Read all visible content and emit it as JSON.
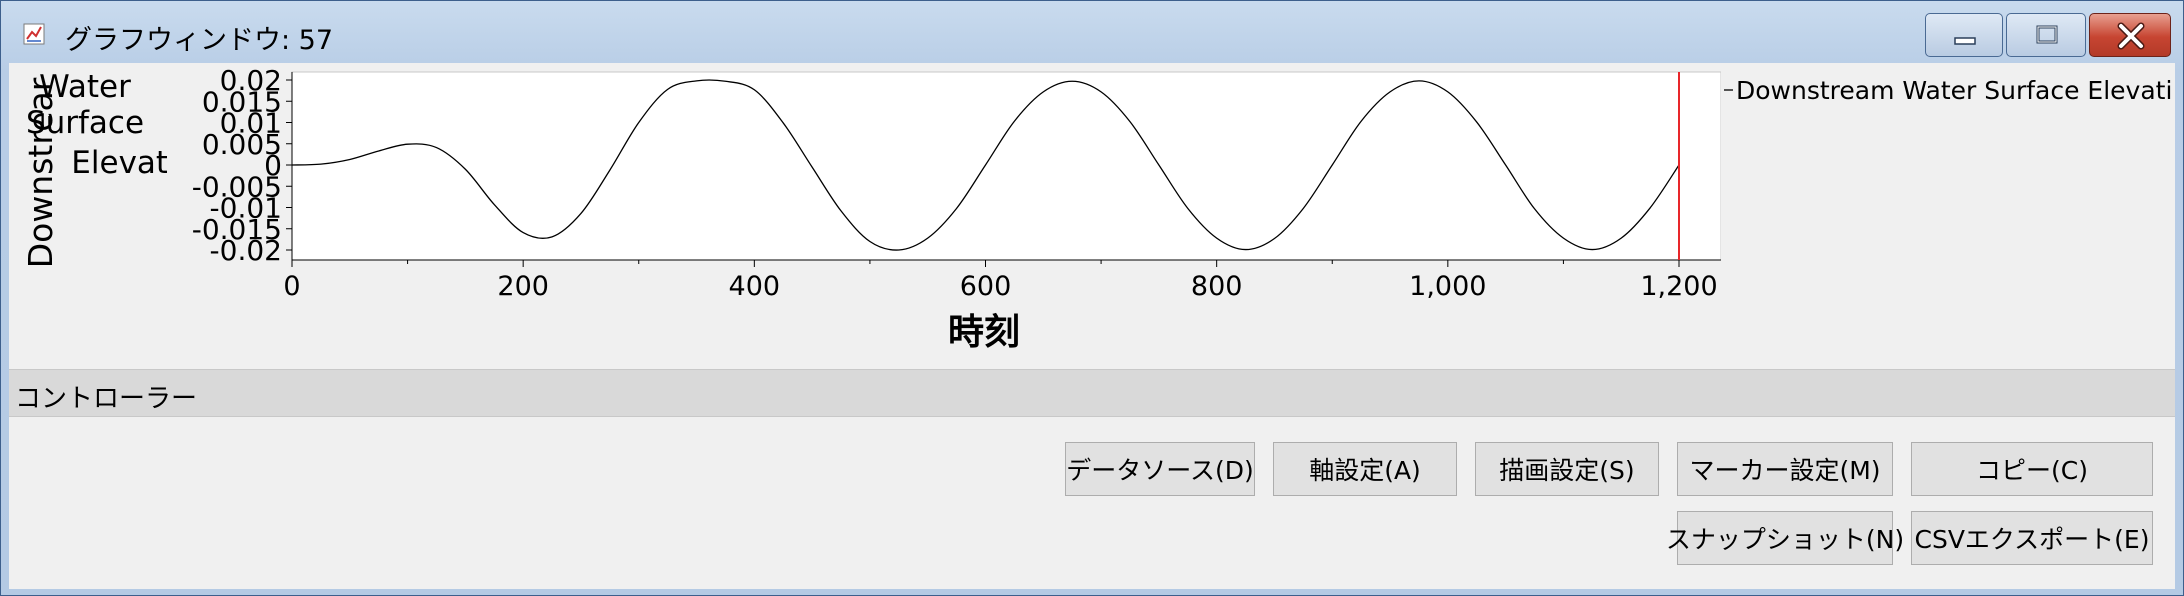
{
  "window": {
    "title": "グラフウィンドウ: 57",
    "controls": [
      "minimize-icon",
      "maximize-icon",
      "close-icon"
    ]
  },
  "chart_data": {
    "type": "line",
    "title": "",
    "xlabel": "時刻",
    "ylabel": "Downstream Water Surface Elevati",
    "ylabel_lines": [
      "Downstrear",
      "Water",
      "Surface",
      "Elevati"
    ],
    "xlim": [
      0,
      1200
    ],
    "ylim": [
      -0.02,
      0.02
    ],
    "x_ticks": [
      0,
      200,
      400,
      600,
      800,
      1000,
      1200
    ],
    "x_tick_labels": [
      "0",
      "200",
      "400",
      "600",
      "800",
      "1,000",
      "1,200"
    ],
    "y_ticks": [
      0.02,
      0.015,
      0.01,
      0.005,
      0,
      -0.005,
      -0.01,
      -0.015,
      -0.02
    ],
    "y_tick_labels": [
      "0.02",
      "0.015",
      "0.01",
      "0.005",
      "0",
      "-0.005",
      "-0.01",
      "-0.015",
      "-0.02"
    ],
    "legend": "right",
    "marker_x": 1200,
    "marker_color": "#e8262a",
    "line_color": "#000000",
    "series": [
      {
        "name": "Downstream Water Surface Elevati",
        "x": [
          0,
          25,
          50,
          75,
          100,
          125,
          150,
          175,
          200,
          225,
          250,
          275,
          300,
          325,
          350,
          375,
          400,
          425,
          450,
          475,
          500,
          525,
          550,
          575,
          600,
          625,
          650,
          675,
          700,
          725,
          750,
          775,
          800,
          825,
          850,
          875,
          900,
          925,
          950,
          975,
          1000,
          1025,
          1050,
          1075,
          1100,
          1125,
          1150,
          1175,
          1200
        ],
        "y": [
          0.0,
          0.0002,
          0.0013,
          0.0033,
          0.0049,
          0.0041,
          -0.001,
          -0.0093,
          -0.0159,
          -0.0169,
          -0.0114,
          -0.0012,
          0.01,
          0.0178,
          0.0198,
          0.0197,
          0.0177,
          0.0099,
          -0.0005,
          -0.0108,
          -0.018,
          -0.02,
          -0.0172,
          -0.0102,
          0.0,
          0.0103,
          0.0172,
          0.0197,
          0.0172,
          0.0102,
          0.0,
          -0.0102,
          -0.0172,
          -0.0199,
          -0.0173,
          -0.0102,
          0.0,
          0.0103,
          0.0172,
          0.0198,
          0.0172,
          0.0101,
          0.0,
          -0.0103,
          -0.0172,
          -0.0199,
          -0.0172,
          -0.0101,
          0.0
        ]
      }
    ]
  },
  "legend": {
    "label": "Downstream Water Surface Elevati"
  },
  "controller": {
    "label": "コントローラー"
  },
  "buttons": {
    "datasource": "データソース(D)",
    "axis": "軸設定(A)",
    "draw": "描画設定(S)",
    "marker": "マーカー設定(M)",
    "copy": "コピー(C)",
    "snapshot": "スナップショット(N)",
    "csv": "CSVエクスポート(E)"
  }
}
